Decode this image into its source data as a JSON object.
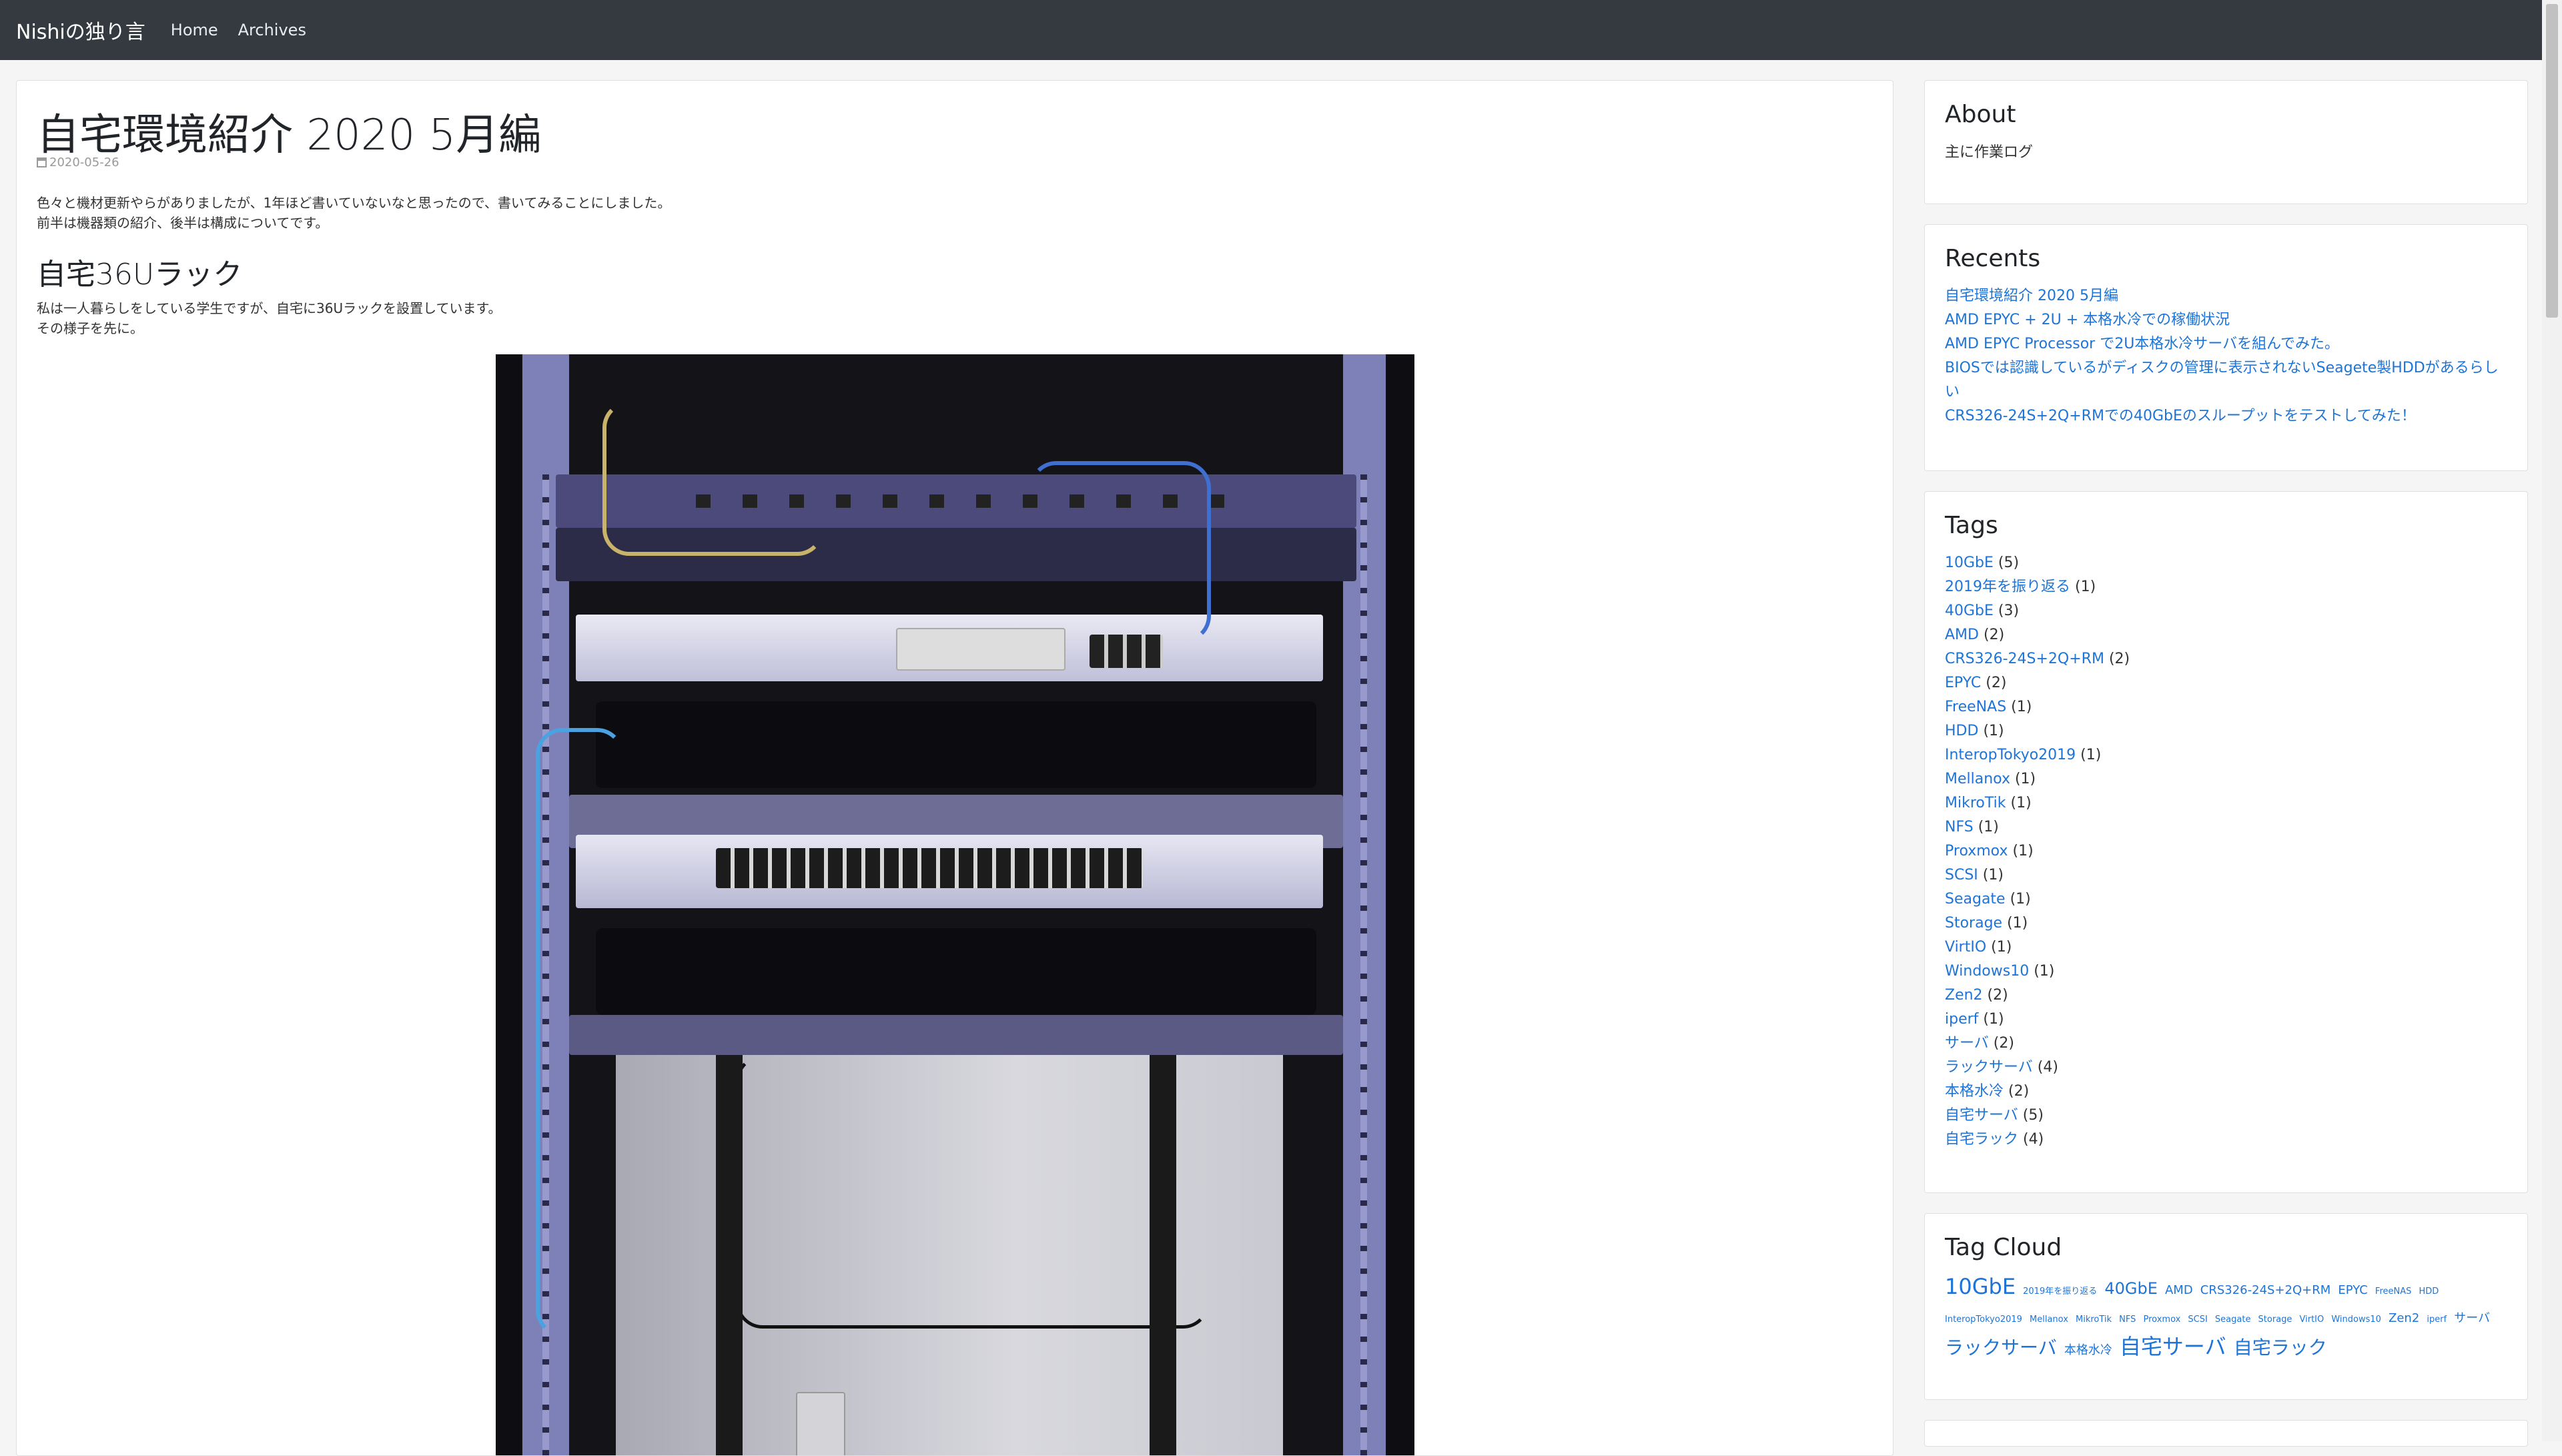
{
  "nav": {
    "brand": "Nishiの独り言",
    "links": [
      "Home",
      "Archives"
    ]
  },
  "post": {
    "title": "自宅環境紹介 2020 5月編",
    "date": "2020-05-26",
    "intro": [
      "色々と機材更新やらがありましたが、1年ほど書いていないなと思ったので、書いてみることにしました。",
      "前半は機器類の紹介、後半は構成についてです。"
    ],
    "section_title": "自宅36Uラック",
    "section_text": [
      "私は一人暮らしをしている学生ですが、自宅に36Uラックを設置しています。",
      "その様子を先に。"
    ]
  },
  "sidebar": {
    "about": {
      "title": "About",
      "text": "主に作業ログ"
    },
    "recents": {
      "title": "Recents",
      "items": [
        "自宅環境紹介 2020 5月編",
        "AMD EPYC + 2U + 本格水冷での稼働状況",
        "AMD EPYC Processor で2U本格水冷サーバを組んでみた。",
        "BIOSでは認識しているがディスクの管理に表示されないSeagete製HDDがあるらしい",
        "CRS326-24S+2Q+RMでの40GbEのスループットをテストしてみた！"
      ]
    },
    "tags": {
      "title": "Tags",
      "items": [
        {
          "name": "10GbE",
          "count": "(5)"
        },
        {
          "name": "2019年を振り返る",
          "count": "(1)"
        },
        {
          "name": "40GbE",
          "count": "(3)"
        },
        {
          "name": "AMD",
          "count": "(2)"
        },
        {
          "name": "CRS326-24S+2Q+RM",
          "count": "(2)"
        },
        {
          "name": "EPYC",
          "count": "(2)"
        },
        {
          "name": "FreeNAS",
          "count": "(1)"
        },
        {
          "name": "HDD",
          "count": "(1)"
        },
        {
          "name": "InteropTokyo2019",
          "count": "(1)"
        },
        {
          "name": "Mellanox",
          "count": "(1)"
        },
        {
          "name": "MikroTik",
          "count": "(1)"
        },
        {
          "name": "NFS",
          "count": "(1)"
        },
        {
          "name": "Proxmox",
          "count": "(1)"
        },
        {
          "name": "SCSI",
          "count": "(1)"
        },
        {
          "name": "Seagate",
          "count": "(1)"
        },
        {
          "name": "Storage",
          "count": "(1)"
        },
        {
          "name": "VirtIO",
          "count": "(1)"
        },
        {
          "name": "Windows10",
          "count": "(1)"
        },
        {
          "name": "Zen2",
          "count": "(2)"
        },
        {
          "name": "iperf",
          "count": "(1)"
        },
        {
          "name": "サーバ",
          "count": "(2)"
        },
        {
          "name": "ラックサーバ",
          "count": "(4)"
        },
        {
          "name": "本格水冷",
          "count": "(2)"
        },
        {
          "name": "自宅サーバ",
          "count": "(5)"
        },
        {
          "name": "自宅ラック",
          "count": "(4)"
        }
      ]
    },
    "tag_cloud": {
      "title": "Tag Cloud",
      "items": [
        {
          "name": "10GbE",
          "size": "xl"
        },
        {
          "name": "2019年を振り返る",
          "size": "xs"
        },
        {
          "name": "40GbE",
          "size": "m"
        },
        {
          "name": "AMD",
          "size": "s"
        },
        {
          "name": "CRS326-24S+2Q+RM",
          "size": "s"
        },
        {
          "name": "EPYC",
          "size": "s"
        },
        {
          "name": "FreeNAS",
          "size": "xs"
        },
        {
          "name": "HDD",
          "size": "xs"
        },
        {
          "name": "InteropTokyo2019",
          "size": "xs"
        },
        {
          "name": "Mellanox",
          "size": "xs"
        },
        {
          "name": "MikroTik",
          "size": "xs"
        },
        {
          "name": "NFS",
          "size": "xs"
        },
        {
          "name": "Proxmox",
          "size": "xs"
        },
        {
          "name": "SCSI",
          "size": "xs"
        },
        {
          "name": "Seagate",
          "size": "xs"
        },
        {
          "name": "Storage",
          "size": "xs"
        },
        {
          "name": "VirtIO",
          "size": "xs"
        },
        {
          "name": "Windows10",
          "size": "xs"
        },
        {
          "name": "Zen2",
          "size": "s"
        },
        {
          "name": "iperf",
          "size": "xs"
        },
        {
          "name": "サーバ",
          "size": "s"
        },
        {
          "name": "ラックサーバ",
          "size": "l"
        },
        {
          "name": "本格水冷",
          "size": "s"
        },
        {
          "name": "自宅サーバ",
          "size": "xl"
        },
        {
          "name": "自宅ラック",
          "size": "l"
        }
      ]
    }
  },
  "colors": {
    "navbar": "#343a40",
    "link": "#1e74d6",
    "page_bg": "#f5f5f5",
    "rack_purple": "#7e80b8"
  },
  "icons": [
    "calendar-icon"
  ]
}
